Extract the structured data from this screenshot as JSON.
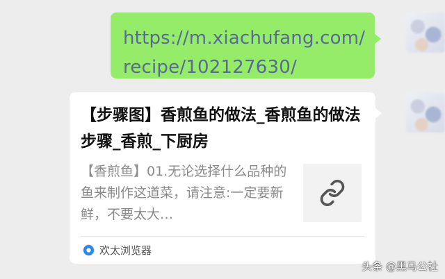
{
  "message_link": {
    "line1": "https://m.xiachufang.com/",
    "line2": "recipe/102127630/"
  },
  "share_card": {
    "title": "【步骤图】香煎鱼的做法_香煎鱼的做法步骤_香煎_下厨房",
    "description": "【香煎鱼】01.无论选择什么品种的鱼来制作这道菜，请注意:一定要新鲜，不要太大…",
    "thumbnail_icon": "link-icon",
    "source_icon": "browser-icon",
    "source_label": "欢太浏览器"
  },
  "watermark": "头条 @黑马公社",
  "colors": {
    "chat_background": "#ededed",
    "sent_bubble": "#95ec69",
    "link_text": "#576b95",
    "card_background": "#ffffff"
  }
}
